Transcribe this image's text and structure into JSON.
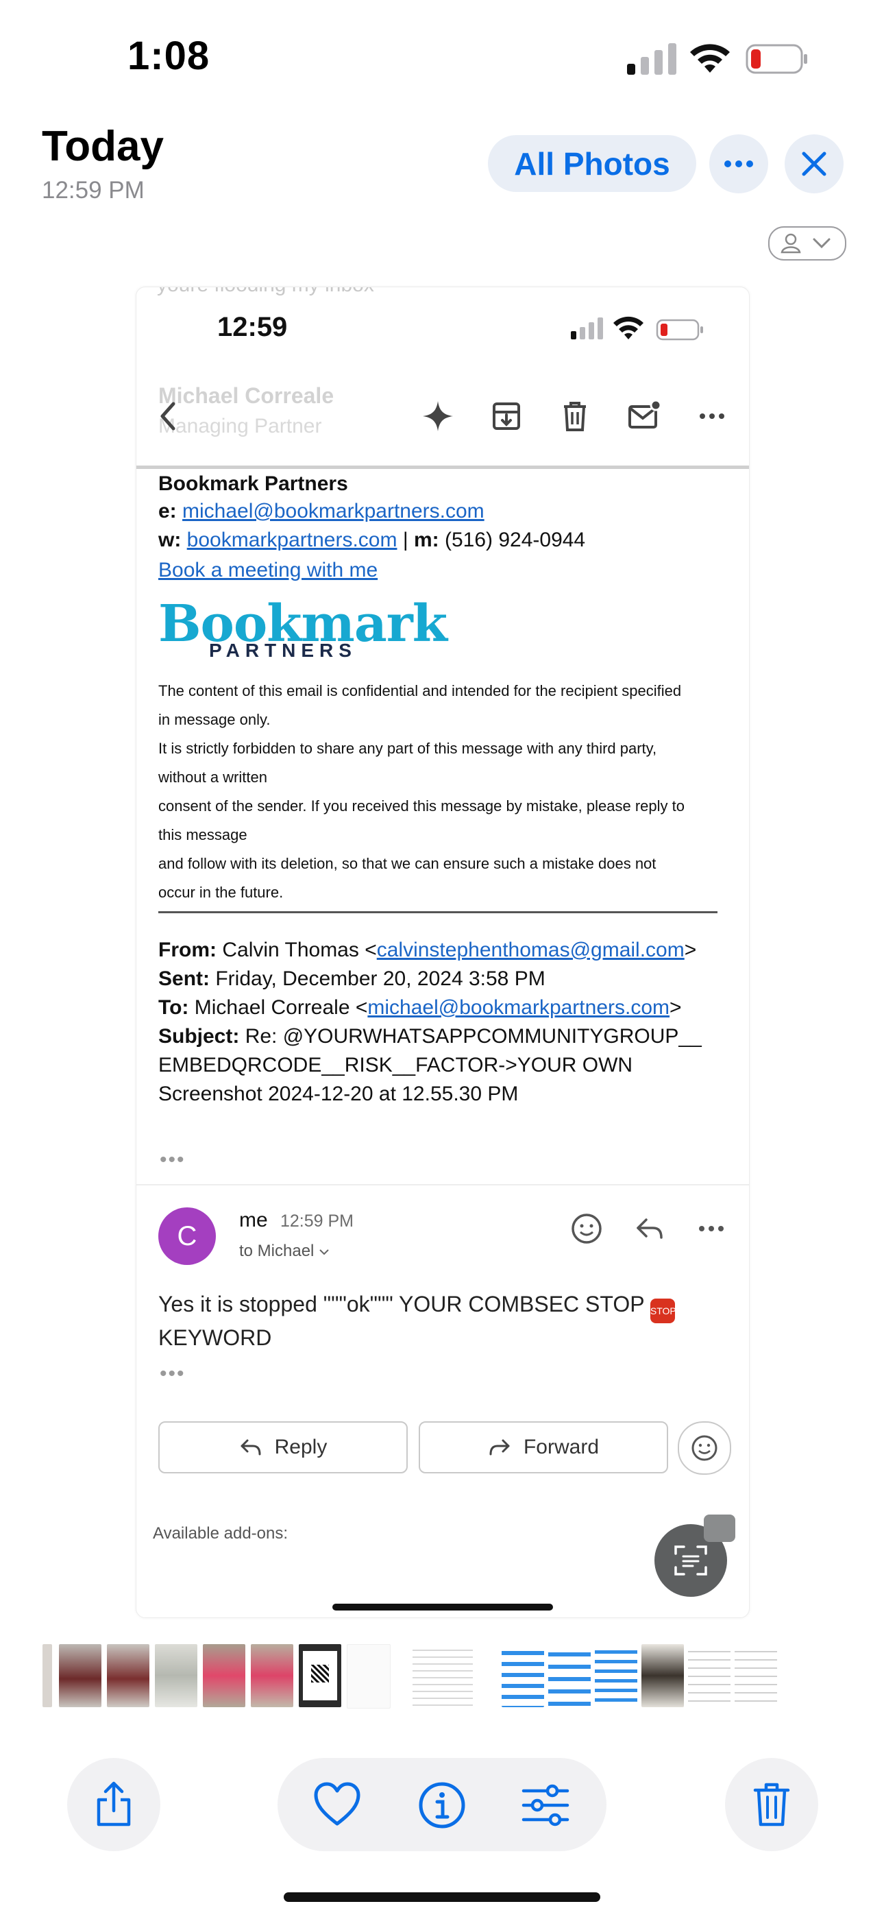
{
  "status_bar": {
    "time": "1:08"
  },
  "header": {
    "title": "Today",
    "subtitle": "12:59 PM",
    "all_photos_label": "All Photos"
  },
  "screenshot": {
    "ghost_text": "youre flooding my inbox",
    "status_time": "12:59",
    "ghost_sender": "Michael Correale",
    "ghost_role": "Managing Partner",
    "signature": {
      "company": "Bookmark Partners",
      "e_label": "e:",
      "email": "michael@bookmarkpartners.com",
      "w_label": "w:",
      "website": "bookmarkpartners.com",
      "separator": "|",
      "m_label": "m:",
      "phone": "(516) 924-0944",
      "meeting_link": "Book a meeting with me",
      "logo_main": "Bookmark",
      "logo_sub": "PARTNERS"
    },
    "disclaimer": [
      "The content of this email is confidential and intended for the recipient specified",
      "in message only.",
      "It is strictly forbidden to share any part of this message with any third party,",
      "without a written",
      "consent of the sender. If you received this message by mistake, please reply to",
      "this message",
      "and follow with its deletion, so that we can ensure such a mistake does not",
      "occur in the future."
    ],
    "quoted": {
      "from_label": "From:",
      "from_name": "Calvin Thomas <",
      "from_email": "calvinstephenthomas@gmail.com",
      "from_close": ">",
      "sent_label": "Sent:",
      "sent_value": "Friday, December 20, 2024 3:58 PM",
      "to_label": "To:",
      "to_name": "Michael Correale <",
      "to_email": "michael@bookmarkpartners.com",
      "to_close": ">",
      "subject_label": "Subject:",
      "subject_line1": "Re: @YOURWHATSAPPCOMMUNITYGROUP__",
      "subject_line2": "EMBEDQRCODE__RISK__FACTOR->YOUR OWN",
      "subject_line3": "Screenshot 2024-12-20 at 12.55.30 PM"
    },
    "ellipsis": "•••",
    "reply_message": {
      "avatar_letter": "C",
      "sender": "me",
      "time": "12:59 PM",
      "to": "to Michael",
      "body_line1": "Yes it is stopped \"\"\"ok\"\"\" YOUR COMBSEC STOP",
      "body_line2": "KEYWORD"
    },
    "reply_label": "Reply",
    "forward_label": "Forward",
    "addons_label": "Available add-ons:"
  },
  "colors": {
    "accent": "#0a6ee6",
    "link": "#1a65c6",
    "logo": "#17a8d1",
    "avatar": "#a43fc0"
  },
  "icons": [
    "share-icon",
    "heart-icon",
    "info-icon",
    "adjust-icon",
    "trash-icon",
    "ellipsis-icon",
    "close-icon",
    "person-icon"
  ]
}
